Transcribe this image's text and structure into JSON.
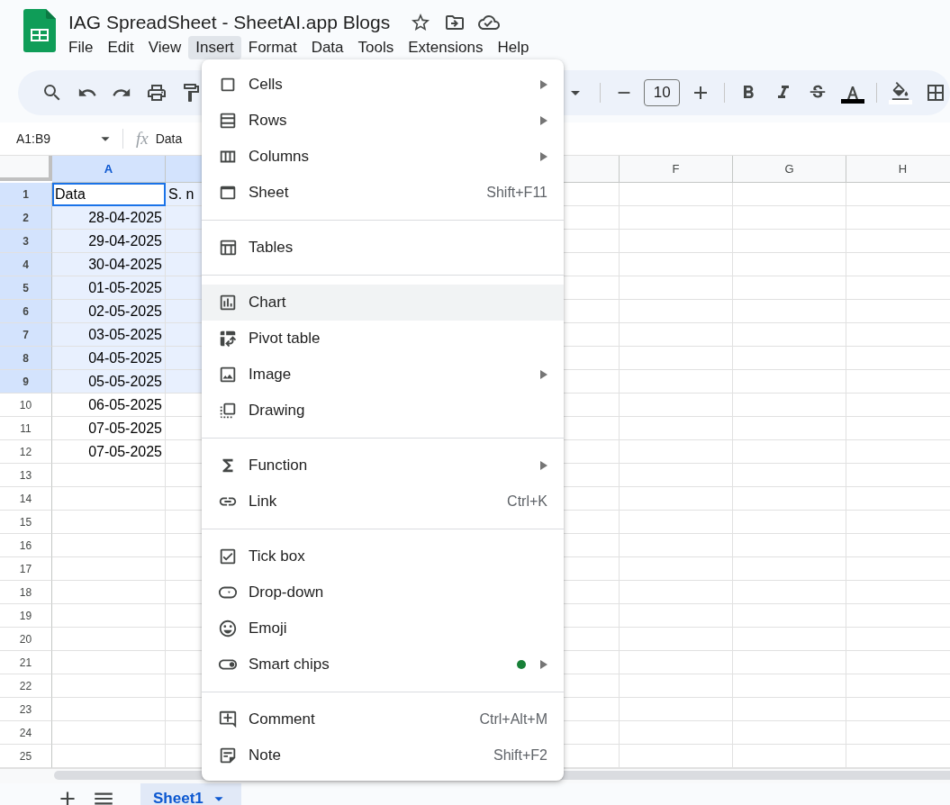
{
  "document": {
    "title": "IAG SpreadSheet - SheetAI.app Blogs"
  },
  "menu_bar": [
    {
      "label": "File",
      "selected": false
    },
    {
      "label": "Edit",
      "selected": false
    },
    {
      "label": "View",
      "selected": false
    },
    {
      "label": "Insert",
      "selected": true
    },
    {
      "label": "Format",
      "selected": false
    },
    {
      "label": "Data",
      "selected": false
    },
    {
      "label": "Tools",
      "selected": false
    },
    {
      "label": "Extensions",
      "selected": false
    },
    {
      "label": "Help",
      "selected": false
    }
  ],
  "toolbar": {
    "font_size": "10"
  },
  "formula_bar": {
    "name_box": "A1:B9",
    "fx_label": "fx",
    "value": "Data"
  },
  "grid": {
    "columns": [
      {
        "label": "A",
        "selected": true
      },
      {
        "selected": true
      },
      {},
      {},
      {
        "selected": false
      },
      {
        "label": "F",
        "selected": false
      },
      {
        "label": "G",
        "selected": false
      },
      {
        "label": "H",
        "selected": false
      }
    ],
    "rows": [
      {
        "label": "1",
        "selected": true,
        "cells": [
          "Data",
          "S. n"
        ]
      },
      {
        "label": "2",
        "selected": true,
        "cells": [
          "28-04-2025"
        ]
      },
      {
        "label": "3",
        "selected": true,
        "cells": [
          "29-04-2025"
        ]
      },
      {
        "label": "4",
        "selected": true,
        "cells": [
          "30-04-2025"
        ]
      },
      {
        "label": "5",
        "selected": true,
        "cells": [
          "01-05-2025"
        ]
      },
      {
        "label": "6",
        "selected": true,
        "cells": [
          "02-05-2025"
        ]
      },
      {
        "label": "7",
        "selected": true,
        "cells": [
          "03-05-2025"
        ]
      },
      {
        "label": "8",
        "selected": true,
        "cells": [
          "04-05-2025"
        ]
      },
      {
        "label": "9",
        "selected": true,
        "cells": [
          "05-05-2025"
        ]
      },
      {
        "label": "10",
        "selected": false,
        "cells": [
          "06-05-2025"
        ]
      },
      {
        "label": "11",
        "selected": false,
        "cells": [
          "07-05-2025"
        ]
      },
      {
        "label": "12",
        "selected": false,
        "cells": [
          "07-05-2025"
        ]
      },
      {
        "label": "13",
        "selected": false,
        "cells": []
      },
      {
        "label": "14",
        "selected": false,
        "cells": []
      },
      {
        "label": "15",
        "selected": false,
        "cells": []
      },
      {
        "label": "16",
        "selected": false,
        "cells": []
      },
      {
        "label": "17",
        "selected": false,
        "cells": []
      },
      {
        "label": "18",
        "selected": false,
        "cells": []
      },
      {
        "label": "19",
        "selected": false,
        "cells": []
      },
      {
        "label": "20",
        "selected": false,
        "cells": []
      },
      {
        "label": "21",
        "selected": false,
        "cells": []
      },
      {
        "label": "22",
        "selected": false,
        "cells": []
      },
      {
        "label": "23",
        "selected": false,
        "cells": []
      },
      {
        "label": "24",
        "selected": false,
        "cells": []
      },
      {
        "label": "25",
        "selected": false,
        "cells": []
      }
    ]
  },
  "insert_menu": {
    "sections": [
      [
        {
          "label": "Cells",
          "submenu": true,
          "selected": false
        },
        {
          "label": "Rows",
          "submenu": true,
          "selected": false
        },
        {
          "label": "Columns",
          "submenu": true,
          "selected": false
        },
        {
          "label": "Sheet",
          "shortcut": "Shift+F11",
          "submenu": false,
          "selected": false
        }
      ],
      [
        {
          "label": "Tables",
          "submenu": false,
          "selected": false
        }
      ],
      [
        {
          "label": "Chart",
          "submenu": false,
          "selected": true
        },
        {
          "label": "Pivot table",
          "submenu": false,
          "selected": false
        },
        {
          "label": "Image",
          "submenu": true,
          "selected": false
        },
        {
          "label": "Drawing",
          "submenu": false,
          "selected": false
        }
      ],
      [
        {
          "label": "Function",
          "submenu": true,
          "selected": false
        },
        {
          "label": "Link",
          "shortcut": "Ctrl+K",
          "submenu": false,
          "selected": false
        }
      ],
      [
        {
          "label": "Tick box",
          "submenu": false,
          "selected": false
        },
        {
          "label": "Drop-down",
          "submenu": false,
          "selected": false
        },
        {
          "label": "Emoji",
          "submenu": false,
          "selected": false
        },
        {
          "label": "Smart chips",
          "submenu": true,
          "new_dot": true,
          "selected": false
        }
      ],
      [
        {
          "label": "Comment",
          "shortcut": "Ctrl+Alt+M",
          "submenu": false,
          "selected": false
        },
        {
          "label": "Note",
          "shortcut": "Shift+F2",
          "submenu": false,
          "selected": false
        }
      ]
    ]
  },
  "sheet_tabs": [
    {
      "label": "Sheet1",
      "selected": true
    }
  ]
}
